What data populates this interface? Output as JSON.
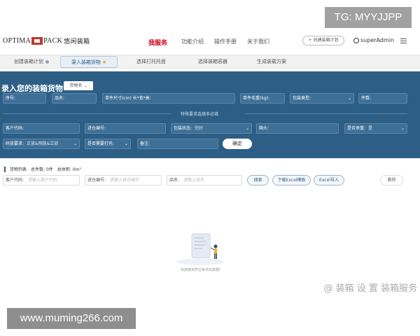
{
  "watermarks": {
    "tg": "TG: MYYJJPP",
    "site": "www.muming266.com",
    "corner": "@ 装箱 设 置 装箱服务"
  },
  "header": {
    "logo_left": "OPTIMA",
    "logo_right": "PACK",
    "logo_cn": "悠闲装箱",
    "nav": [
      {
        "label": "我服务",
        "active": true
      },
      {
        "label": "功能介绍"
      },
      {
        "label": "操作手册"
      },
      {
        "label": "关于我们"
      }
    ],
    "new_plan": "+ 创建装箱计划",
    "username": "superAdmin"
  },
  "steps": [
    {
      "label": "创建装箱计划"
    },
    {
      "label": "录入装箱货物",
      "active": true
    },
    {
      "label": "选择打托托盘"
    },
    {
      "label": "选择装箱容器"
    },
    {
      "label": "生成装载方案"
    }
  ],
  "form": {
    "title": "录入您的装箱货物",
    "cargo_btn": "货物名 ⌄",
    "row1": [
      "序号:",
      "品名:",
      "单件尺寸(cm) 长*宽*高:",
      "单件毛重(kg):",
      "包装类型:",
      "件数:"
    ],
    "divider_label": "特殊要求选填非必填",
    "row2": {
      "customer_code": "客户代码:",
      "order_no": "进仓编号:",
      "pack_status": "包装状态:",
      "pack_status_value": "完好",
      "side": "箱头:",
      "stackable": "是否承重:",
      "stackable_value": "是"
    },
    "row3": {
      "place_req": "码放要求:",
      "place_req_value": "正放&侧放&立放",
      "pallet": "是否需要打托:",
      "remark": "备注:"
    },
    "confirm": "确定"
  },
  "list": {
    "title": "货物列表",
    "total_count": "总件数: 0件",
    "total_volume": "总体积: 0m³",
    "customer_label": "客户代码:",
    "customer_ph": "请输入客户代码",
    "order_label": "进仓编号:",
    "order_ph": "请输入进仓编号",
    "name_label": "品名:",
    "name_ph": "请输入品名",
    "search": "搜索",
    "download": "下载Excel模板",
    "import": "Excel导入",
    "delete": "删除",
    "empty": "未搜索到符合条件的数据!"
  }
}
